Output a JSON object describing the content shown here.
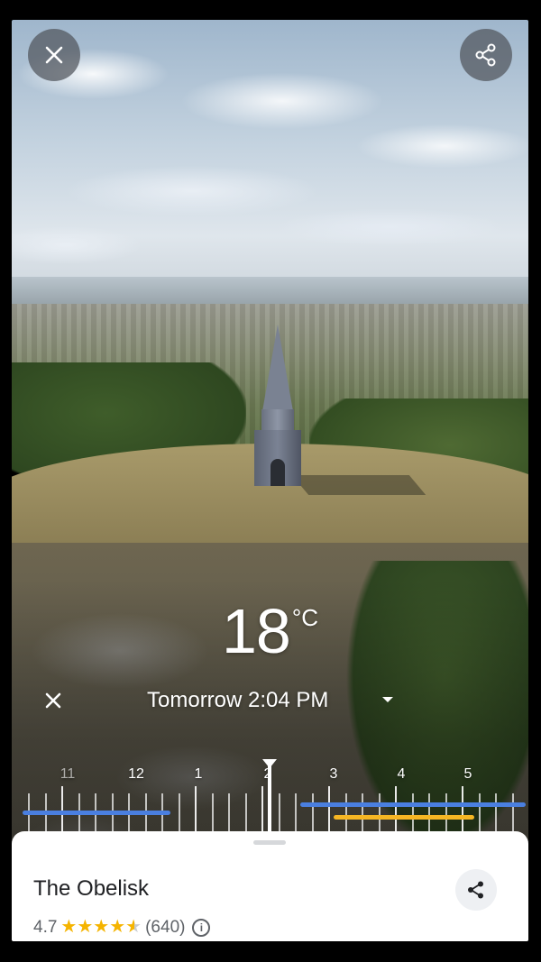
{
  "weather": {
    "temperature": "18",
    "unit": "°C",
    "time_label": "Tomorrow 2:04 PM"
  },
  "timeline": {
    "hours": [
      "11",
      "12",
      "1",
      "2",
      "3",
      "4",
      "5"
    ],
    "colors": {
      "blue": "#4a7fe0",
      "yellow": "#f6b623"
    }
  },
  "place": {
    "name": "The Obelisk",
    "rating": "4.7",
    "rating_value": 4.7,
    "reviews": "(640)"
  }
}
